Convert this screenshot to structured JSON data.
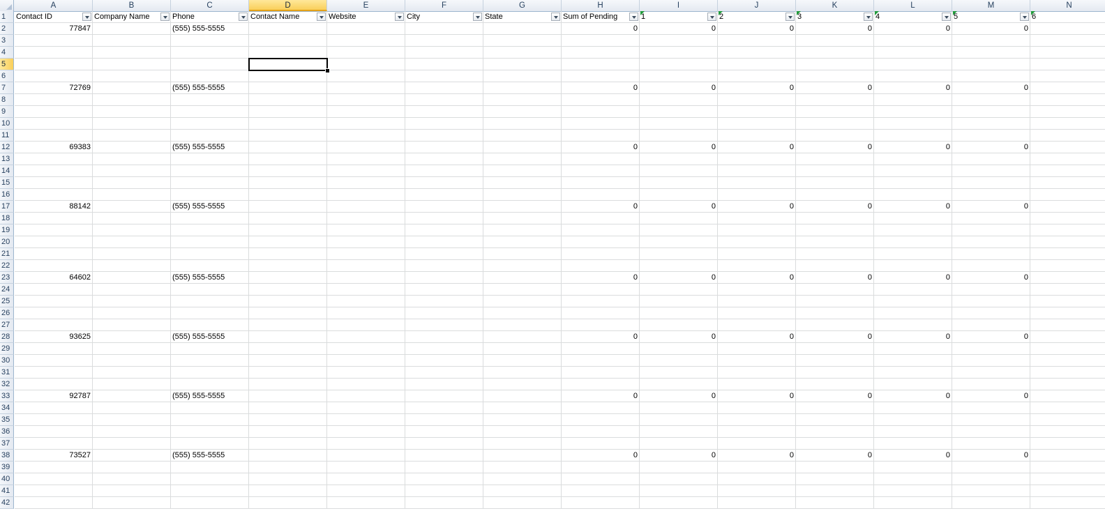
{
  "columns": [
    {
      "letter": "A",
      "header": "Contact ID",
      "numeric": true
    },
    {
      "letter": "B",
      "header": "Company Name",
      "numeric": false
    },
    {
      "letter": "C",
      "header": "Phone",
      "numeric": false
    },
    {
      "letter": "D",
      "header": "Contact Name",
      "numeric": false
    },
    {
      "letter": "E",
      "header": "Website",
      "numeric": false
    },
    {
      "letter": "F",
      "header": "City",
      "numeric": false
    },
    {
      "letter": "G",
      "header": "State",
      "numeric": false
    },
    {
      "letter": "H",
      "header": "Sum of Pending",
      "numeric": true
    },
    {
      "letter": "I",
      "header": "1",
      "numeric": true
    },
    {
      "letter": "J",
      "header": "2",
      "numeric": true
    },
    {
      "letter": "K",
      "header": "3",
      "numeric": true
    },
    {
      "letter": "L",
      "header": "4",
      "numeric": true
    },
    {
      "letter": "M",
      "header": "5",
      "numeric": true
    },
    {
      "letter": "N",
      "header": "6",
      "numeric": true
    }
  ],
  "active_cell": {
    "column": "D",
    "row": 5
  },
  "row_count": 42,
  "records": [
    {
      "row": 2,
      "contact_id": "77847",
      "phone": "(555) 555-5555",
      "values": [
        "0",
        "0",
        "0",
        "0",
        "0",
        "0"
      ]
    },
    {
      "row": 7,
      "contact_id": "72769",
      "phone": "(555) 555-5555",
      "values": [
        "0",
        "0",
        "0",
        "0",
        "0",
        "0"
      ]
    },
    {
      "row": 12,
      "contact_id": "69383",
      "phone": "(555) 555-5555",
      "values": [
        "0",
        "0",
        "0",
        "0",
        "0",
        "0"
      ]
    },
    {
      "row": 17,
      "contact_id": "88142",
      "phone": "(555) 555-5555",
      "values": [
        "0",
        "0",
        "0",
        "0",
        "0",
        "0"
      ]
    },
    {
      "row": 23,
      "contact_id": "64602",
      "phone": "(555) 555-5555",
      "values": [
        "0",
        "0",
        "0",
        "0",
        "0",
        "0"
      ]
    },
    {
      "row": 28,
      "contact_id": "93625",
      "phone": "(555) 555-5555",
      "values": [
        "0",
        "0",
        "0",
        "0",
        "0",
        "0"
      ]
    },
    {
      "row": 33,
      "contact_id": "92787",
      "phone": "(555) 555-5555",
      "values": [
        "0",
        "0",
        "0",
        "0",
        "0",
        "0"
      ]
    },
    {
      "row": 38,
      "contact_id": "73527",
      "phone": "(555) 555-5555",
      "values": [
        "0",
        "0",
        "0",
        "0",
        "0",
        "0"
      ]
    }
  ]
}
